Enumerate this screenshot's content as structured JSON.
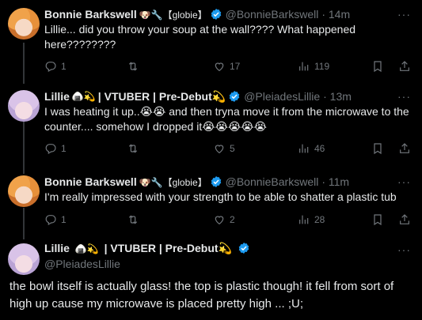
{
  "tweets": [
    {
      "name": "Bonnie Barkswell",
      "emoji": "🐶🔧【globie】",
      "handle": "@BonnieBarkswell",
      "time": "· 14m",
      "text": "Lillie... did you throw your soup at the wall???? What happened here????????",
      "replies": "1",
      "retweets": "",
      "likes": "17",
      "views": "119"
    },
    {
      "name": "Lillie",
      "emoji": "🍙💫",
      "name_suffix": "| VTUBER | Pre-Debut💫",
      "handle": "@PleiadesLillie",
      "time": "· 13m",
      "text": "I was heating it up..😭😭 and then tryna move it from the microwave to the counter.... somehow I dropped it😭😭😭😭😭",
      "replies": "1",
      "retweets": "",
      "likes": "5",
      "views": "46"
    },
    {
      "name": "Bonnie Barkswell",
      "emoji": "🐶🔧【globie】",
      "handle": "@BonnieBarkswell",
      "time": "· 11m",
      "text": "I'm really impressed with your strength to be able to shatter a plastic tub",
      "replies": "1",
      "retweets": "",
      "likes": "2",
      "views": "28"
    }
  ],
  "main": {
    "name": "Lillie",
    "emoji": "🍙💫",
    "name_suffix": "| VTUBER | Pre-Debut💫",
    "handle": "@PleiadesLillie",
    "text": "the bowl itself is actually glass! the top is plastic though! it fell from sort of high up cause my microwave is placed pretty high ... ;U;"
  },
  "icons": {
    "more": "more-icon",
    "reply": "reply-icon",
    "retweet": "retweet-icon",
    "like": "heart-icon",
    "views": "views-icon",
    "bookmark": "bookmark-icon",
    "share": "share-icon",
    "verified": "verified-badge-icon"
  },
  "colors": {
    "background": "#000000",
    "text": "#e7e9ea",
    "muted": "#71767b",
    "verified": "#1d9bf0",
    "divider": "#2f3336"
  }
}
